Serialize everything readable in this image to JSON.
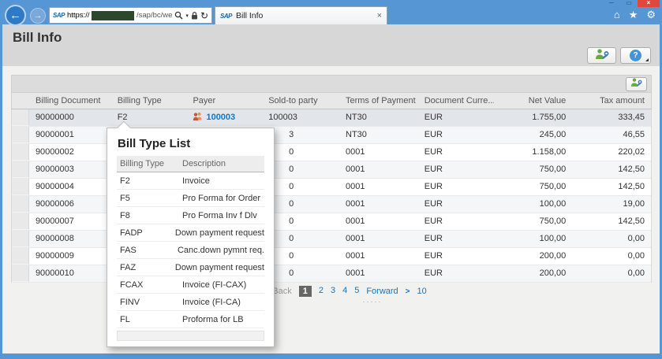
{
  "icons": {
    "minimize": "─",
    "maximize": "▭",
    "close": "×",
    "back": "←",
    "forward": "→",
    "caret": "▾",
    "refresh": "↻",
    "tab_close": "×",
    "home": "⌂",
    "favorites": "★",
    "settings": "⚙",
    "help": "?"
  },
  "browser": {
    "sap_logo_text": "SAP",
    "address": {
      "scheme_text": "https://",
      "path_text": "/sap/bc/we"
    },
    "tab_title": "Bill Info"
  },
  "page": {
    "title": "Bill Info"
  },
  "table": {
    "headers": [
      "",
      "Billing Document",
      "Billing Type",
      "Payer",
      "Sold-to party",
      "Terms of Payment",
      "Document Curre...",
      "Net Value",
      "Tax amount"
    ],
    "rows": [
      {
        "billing_document": "90000000",
        "billing_type": "F2",
        "payer": "100003",
        "payer_icon": true,
        "sold_to": "100003",
        "terms": "NT30",
        "currency": "EUR",
        "net_value": "1.755,00",
        "tax_amount": "333,45",
        "selected": true
      },
      {
        "billing_document": "90000001",
        "billing_type": "",
        "payer": "",
        "sold_to": "3",
        "sold_to_partial": true,
        "terms": "NT30",
        "currency": "EUR",
        "net_value": "245,00",
        "tax_amount": "46,55"
      },
      {
        "billing_document": "90000002",
        "billing_type": "",
        "payer": "",
        "sold_to": "0",
        "sold_to_partial": true,
        "terms": "0001",
        "currency": "EUR",
        "net_value": "1.158,00",
        "tax_amount": "220,02"
      },
      {
        "billing_document": "90000003",
        "billing_type": "",
        "payer": "",
        "sold_to": "0",
        "sold_to_partial": true,
        "terms": "0001",
        "currency": "EUR",
        "net_value": "750,00",
        "tax_amount": "142,50"
      },
      {
        "billing_document": "90000004",
        "billing_type": "",
        "payer": "",
        "sold_to": "0",
        "sold_to_partial": true,
        "terms": "0001",
        "currency": "EUR",
        "net_value": "750,00",
        "tax_amount": "142,50"
      },
      {
        "billing_document": "90000006",
        "billing_type": "",
        "payer": "",
        "sold_to": "0",
        "sold_to_partial": true,
        "terms": "0001",
        "currency": "EUR",
        "net_value": "100,00",
        "tax_amount": "19,00"
      },
      {
        "billing_document": "90000007",
        "billing_type": "",
        "payer": "",
        "sold_to": "0",
        "sold_to_partial": true,
        "terms": "0001",
        "currency": "EUR",
        "net_value": "750,00",
        "tax_amount": "142,50"
      },
      {
        "billing_document": "90000008",
        "billing_type": "",
        "payer": "",
        "sold_to": "0",
        "sold_to_partial": true,
        "terms": "0001",
        "currency": "EUR",
        "net_value": "100,00",
        "tax_amount": "0,00"
      },
      {
        "billing_document": "90000009",
        "billing_type": "",
        "payer": "",
        "sold_to": "0",
        "sold_to_partial": true,
        "terms": "0001",
        "currency": "EUR",
        "net_value": "200,00",
        "tax_amount": "0,00"
      },
      {
        "billing_document": "90000010",
        "billing_type": "",
        "payer": "",
        "sold_to": "0",
        "sold_to_partial": true,
        "terms": "0001",
        "currency": "EUR",
        "net_value": "200,00",
        "tax_amount": "0,00"
      }
    ]
  },
  "pagination": {
    "back_label": "Back",
    "pages": [
      {
        "label": "1",
        "current": true
      },
      {
        "label": "2"
      },
      {
        "label": "3"
      },
      {
        "label": "4"
      },
      {
        "label": "5"
      }
    ],
    "forward_label": "Forward",
    "forward_chevron": ">",
    "last_page": "10",
    "grip": "·····"
  },
  "popup": {
    "title": "Bill Type List",
    "headers": [
      "Billing Type",
      "Description"
    ],
    "rows": [
      {
        "type": "F2",
        "description": "Invoice"
      },
      {
        "type": "F5",
        "description": "Pro Forma for Order"
      },
      {
        "type": "F8",
        "description": "Pro Forma Inv f Dlv"
      },
      {
        "type": "FADP",
        "description": "Down payment request"
      },
      {
        "type": "FAS",
        "description": "Canc.down pymnt req."
      },
      {
        "type": "FAZ",
        "description": "Down payment request"
      },
      {
        "type": "FCAX",
        "description": "Invoice (FI-CAX)"
      },
      {
        "type": "FINV",
        "description": "Invoice (FI-CA)"
      },
      {
        "type": "FL",
        "description": "Proforma for LB"
      }
    ]
  }
}
